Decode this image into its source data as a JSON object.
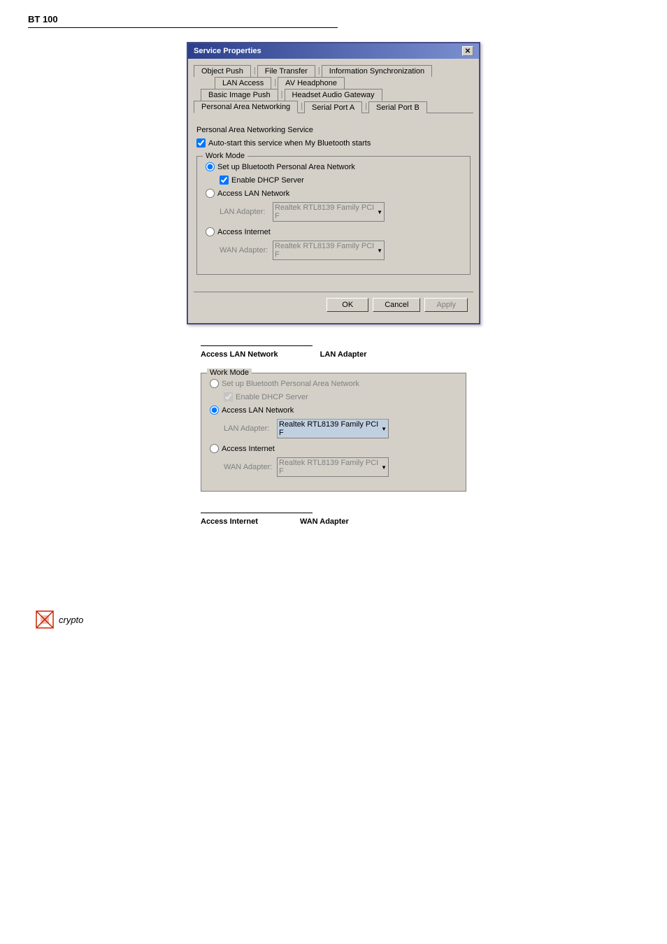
{
  "page": {
    "title": "BT 100"
  },
  "dialog": {
    "title": "Service Properties",
    "tabs": [
      {
        "label": "Object Push",
        "active": false
      },
      {
        "label": "File Transfer",
        "active": false
      },
      {
        "label": "Information Synchronization",
        "active": false
      },
      {
        "label": "LAN Access",
        "active": false
      },
      {
        "label": "AV Headphone",
        "active": false
      },
      {
        "label": "Basic Image Push",
        "active": false
      },
      {
        "label": "Headset Audio Gateway",
        "active": false
      },
      {
        "label": "Personal Area Networking",
        "active": true
      },
      {
        "label": "Serial Port A",
        "active": false
      },
      {
        "label": "Serial Port B",
        "active": false
      }
    ],
    "content": {
      "service_title": "Personal Area Networking Service",
      "autostart_label": "Auto-start this service when My Bluetooth starts",
      "autostart_checked": true,
      "work_mode_legend": "Work Mode",
      "radio1_label": "Set up Bluetooth Personal Area Network",
      "radio1_checked": true,
      "dhcp_label": "Enable DHCP Server",
      "dhcp_checked": true,
      "radio2_label": "Access LAN Network",
      "radio2_checked": false,
      "lan_adapter_label": "LAN Adapter:",
      "lan_adapter_value": "Realtek RTL8139 Family PCI F",
      "radio3_label": "Access Internet",
      "radio3_checked": false,
      "wan_adapter_label": "WAN Adapter:",
      "wan_adapter_value": "Realtek RTL8139 Family PCI F"
    },
    "buttons": {
      "ok_label": "OK",
      "cancel_label": "Cancel",
      "apply_label": "Apply"
    }
  },
  "section1": {
    "line_label": "",
    "left_label": "Access  LAN  Network",
    "right_label": "LAN  Adapter"
  },
  "section2": {
    "work_mode_legend": "Work Mode",
    "radio1_label": "Set up Bluetooth Personal Area Network",
    "dhcp_label": "Enable DHCP Server",
    "radio2_label": "Access LAN Network",
    "lan_adapter_label": "LAN Adapter:",
    "lan_adapter_value": "Realtek RTL8139 Family PCI F",
    "radio3_label": "Access Internet",
    "wan_adapter_label": "WAN Adapter:",
    "wan_adapter_value": "Realtek RTL8139 Family PCI F"
  },
  "section3": {
    "left_label": "Access  Internet",
    "right_label": "WAN  Adapter"
  },
  "logo": {
    "text": "crypto"
  }
}
